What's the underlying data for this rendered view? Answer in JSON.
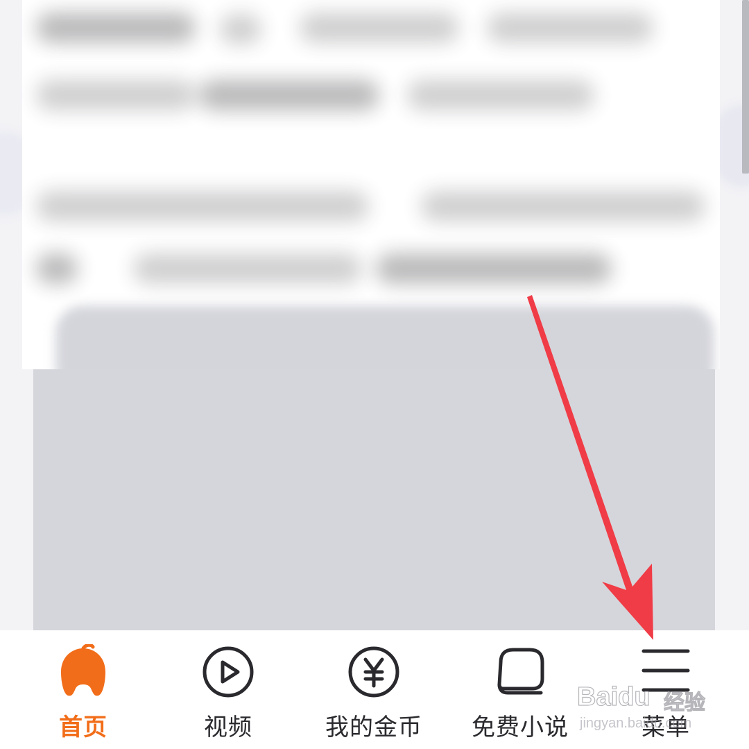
{
  "tabbar": {
    "tabs": [
      {
        "id": "home",
        "label": "首页",
        "icon": "home-icon",
        "active": true
      },
      {
        "id": "video",
        "label": "视频",
        "icon": "play-circle-icon",
        "active": false
      },
      {
        "id": "coins",
        "label": "我的金币",
        "icon": "yen-coin-icon",
        "active": false
      },
      {
        "id": "novel",
        "label": "免费小说",
        "icon": "book-icon",
        "active": false
      },
      {
        "id": "menu",
        "label": "菜单",
        "icon": "hamburger-menu-icon",
        "active": false
      }
    ]
  },
  "colors": {
    "accent": "#f26d19",
    "annotation_arrow": "#f03c46",
    "tab_icon": "#2a2a2e",
    "content_grey": "#d5d6db"
  },
  "watermark": {
    "brand": "Baidu",
    "product": "经验",
    "url": "jingyan.baidu.com"
  }
}
